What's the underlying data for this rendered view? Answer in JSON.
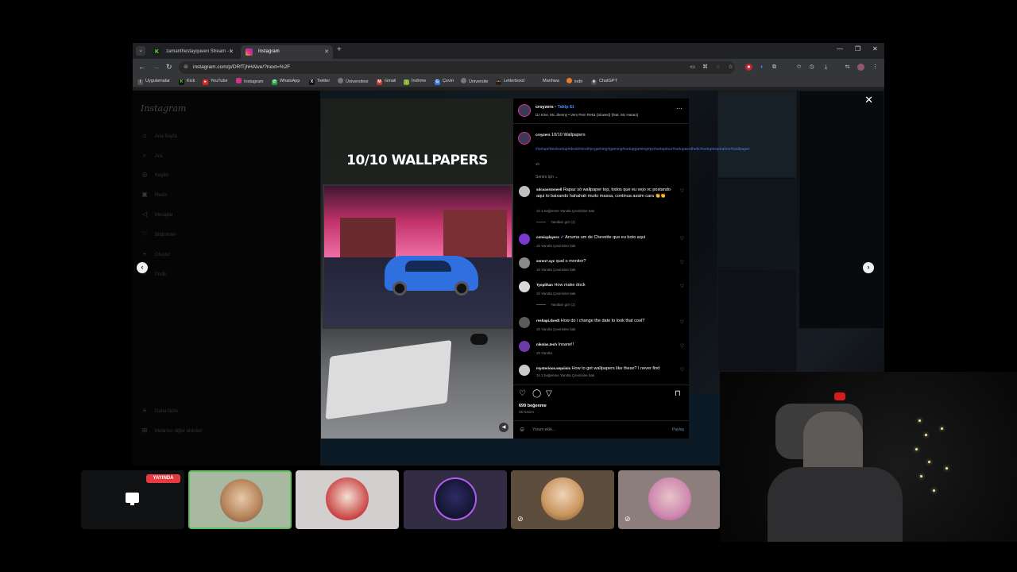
{
  "browser": {
    "tabs": [
      {
        "title": "zamanthestayqueen Stream - I",
        "favicon": "K"
      },
      {
        "title": "Instagram",
        "favicon": "ig"
      }
    ],
    "url": "instagram.com/p/DRfTjhHAlve/?next=%2F",
    "bookmarks": [
      "Uygulamalar",
      "Kick",
      "YouTube",
      "Instagram",
      "WhatsApp",
      "Twitter",
      "Üniversitesi",
      "Gmail",
      "İndirme",
      "Çeviri",
      "Üniversite",
      "Letterboxd",
      "Manhwa",
      "indir",
      "ChatGPT"
    ]
  },
  "ig_sidebar": {
    "logo": "Instagram",
    "items": [
      {
        "label": "Ana Sayfa",
        "icon": "home-icon",
        "glyph": "⌂"
      },
      {
        "label": "Ara",
        "icon": "search-icon",
        "glyph": "⌕"
      },
      {
        "label": "Keşfet",
        "icon": "explore-icon",
        "glyph": "◎"
      },
      {
        "label": "Reels",
        "icon": "reels-icon",
        "glyph": "▣"
      },
      {
        "label": "Mesajlar",
        "icon": "messages-icon",
        "glyph": "◁"
      },
      {
        "label": "Bildirimler",
        "icon": "heart-icon",
        "glyph": "♡"
      },
      {
        "label": "Oluştur",
        "icon": "create-icon",
        "glyph": "+"
      },
      {
        "label": "Profil",
        "icon": "profile-icon",
        "glyph": "○"
      }
    ],
    "bottom": [
      {
        "label": "Daha fazla",
        "icon": "menu-icon",
        "glyph": "≡"
      },
      {
        "label": "Meta'nın diğer ürünleri",
        "icon": "meta-icon",
        "glyph": "⊞"
      }
    ]
  },
  "post": {
    "image_title": "10/10 WALLPAPERS",
    "user": "croyzers",
    "follow": "Takip Et",
    "song": "DJ Kine, Mc Jhenny • Vem Pem Reka (Slowed) (feat. Mc Harani)",
    "caption_user": "croyzers",
    "caption": "10/10 Wallpapers",
    "hashtags": "#setup#desksetup#desk#viral#pcgaming#gaming#setupgaming#pc#setuptour#setupaesthetic#setupinspiration#wallpaper",
    "caption_time": "1h",
    "see_translation": "Seninı için ⌄",
    "likes": "699 beğenme",
    "date": "26 Kasım",
    "add_comment_placeholder": "Yorum ekle...",
    "post_button": "Paylaş"
  },
  "comments": [
    {
      "user": "sdcsavstoneell",
      "text": "Rapaz só wallpaper top, todos que eu vejo vc postando aqui to baixando hahahah muito massa, continua assim cara 👏👏",
      "meta": "1h   1 beğenme   Yanıtla   Çevirisine bak",
      "replies": "Yanıtları gör (1)"
    },
    {
      "user": "comicplayers",
      "text": "Arruma um de Chevette que eu boto aqui",
      "meta": "1h   Yanıtla   Çevirisine bak"
    },
    {
      "user": "seren7.xyz",
      "text": "qual o monitor?",
      "meta": "1h   Yanıtla   Çevirisine bak"
    },
    {
      "user": "Tyoplihan",
      "text": "How make dock",
      "meta": "1h   Yanıtla   Çevirisine bak",
      "replies": "Yanıtları gör (1)"
    },
    {
      "user": "reshapi.dxedt",
      "text": "How do i change the date to look that cool?",
      "meta": "1h   Yanıtla   Çevirisine bak"
    },
    {
      "user": "nikolas.tech",
      "text": "Insane!!",
      "meta": "1h   Yanıtla"
    },
    {
      "user": "mysterious.wquiisis",
      "text": "How to get wallpapers like these? I never find",
      "meta": "1h   2 beğenme   Yanıtla   Çevirisine bak"
    }
  ],
  "stream": {
    "live_badge": "YAYINDA"
  },
  "colors": {
    "accent_link": "#4c78d4",
    "follow_blue": "#4a8eff",
    "live_red": "#e53a40",
    "active_tile_border": "#5fbf5f"
  }
}
